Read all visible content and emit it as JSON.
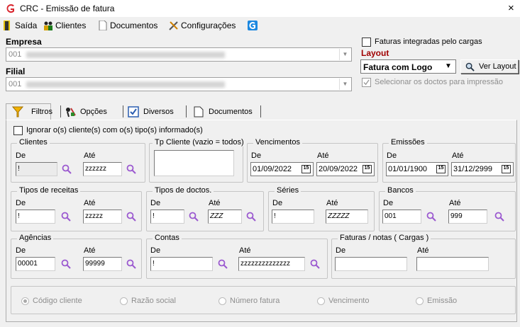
{
  "window": {
    "title": "CRC - Emissão de fatura",
    "close": "×"
  },
  "toolbar": {
    "saida": "Saída",
    "clientes": "Clientes",
    "documentos": "Documentos",
    "configuracoes": "Configurações"
  },
  "empresa": {
    "label": "Empresa",
    "value": "001"
  },
  "filial": {
    "label": "Filial",
    "value": "001"
  },
  "faturas_integradas": {
    "label": "Faturas integradas pelo cargas",
    "checked": false
  },
  "layout": {
    "label": "Layout",
    "value": "Fatura com Logo",
    "ver_layout": "Ver Layout"
  },
  "selecionar_doctos": {
    "label": "Selecionar os doctos para impressão",
    "checked": true
  },
  "tabs": {
    "filtros": "Filtros",
    "opcoes": "Opções",
    "diversos": "Diversos",
    "documentos": "Documentos"
  },
  "ignorar": {
    "label": "Ignorar o(s) cliente(s) com o(s) tipo(s) informado(s)"
  },
  "common": {
    "de": "De",
    "ate": "Até"
  },
  "clientes": {
    "legend": "Clientes",
    "de": "!",
    "ate": "zzzzzz"
  },
  "tp_cliente": {
    "legend": "Tp Cliente (vazio = todos)",
    "value": ""
  },
  "vencimentos": {
    "legend": "Vencimentos",
    "de": "01/09/2022",
    "ate": "20/09/2022"
  },
  "emissoes": {
    "legend": "Emissões",
    "de": "01/01/1900",
    "ate": "31/12/2999"
  },
  "tipos_receitas": {
    "legend": "Tipos de receitas",
    "de": "!",
    "ate": "zzzzz"
  },
  "tipos_doctos": {
    "legend": "Tipos de doctos.",
    "de": "!",
    "ate": "ZZZ"
  },
  "series": {
    "legend": "Séries",
    "de": "!",
    "ate": "ZZZZZ"
  },
  "bancos": {
    "legend": "Bancos",
    "de": "001",
    "ate": "999"
  },
  "agencias": {
    "legend": "Agências",
    "de": "00001",
    "ate": "99999"
  },
  "contas": {
    "legend": "Contas",
    "de": "!",
    "ate": "zzzzzzzzzzzzzz"
  },
  "faturas_notas": {
    "legend": "Faturas / notas ( Cargas )",
    "de": "",
    "ate": ""
  },
  "ordenacao": {
    "options": [
      "Código cliente",
      "Razão social",
      "Número fatura",
      "Vencimento",
      "Emissão"
    ],
    "selected": 0
  },
  "icons": {
    "app": "app-logo-icon",
    "exit": "exit-door-icon",
    "clients": "clients-icon",
    "docs": "document-icon",
    "config": "tools-icon",
    "extra": "g-icon",
    "filter": "filter-funnel-icon",
    "options": "options-icon",
    "check": "checkmark-icon",
    "doc": "document-icon",
    "search": "magnifier-icon",
    "calendar": "calendar-icon"
  },
  "colors": {
    "accent": "#a00000",
    "magnifier": "#9b59d0",
    "background": "#f0f0f0"
  }
}
